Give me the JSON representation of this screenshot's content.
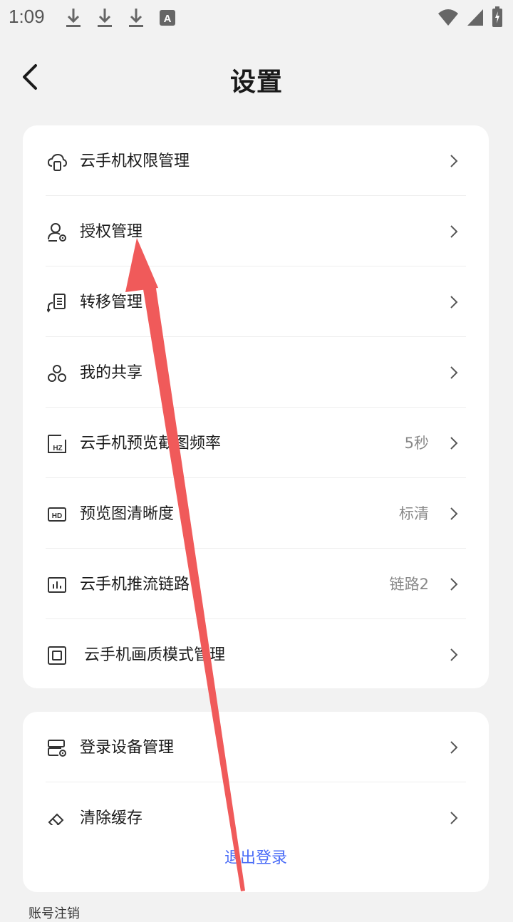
{
  "status_bar": {
    "time": "1:09",
    "left_icons": [
      "download-icon",
      "download-icon",
      "download-icon",
      "a-badge-icon"
    ],
    "right_icons": [
      "wifi-icon",
      "signal-icon",
      "battery-charging-icon"
    ]
  },
  "header": {
    "title": "设置"
  },
  "group1": [
    {
      "label": "云手机权限管理",
      "icon": "cloud-phone-icon",
      "value": ""
    },
    {
      "label": "授权管理",
      "icon": "user-auth-icon",
      "value": ""
    },
    {
      "label": "转移管理",
      "icon": "transfer-icon",
      "value": ""
    },
    {
      "label": "我的共享",
      "icon": "share-icon",
      "value": ""
    },
    {
      "label": "云手机预览截图频率",
      "icon": "hz-icon",
      "value": "5秒"
    },
    {
      "label": "预览图清晰度",
      "icon": "hd-icon",
      "value": "标清"
    },
    {
      "label": "云手机推流链路",
      "icon": "chart-icon",
      "value": "链路2"
    },
    {
      "label": "云手机画质模式管理",
      "icon": "quality-icon",
      "value": ""
    }
  ],
  "group2": [
    {
      "label": "登录设备管理",
      "icon": "device-icon",
      "value": ""
    },
    {
      "label": "清除缓存",
      "icon": "eraser-icon",
      "value": ""
    }
  ],
  "logout_label": "退出登录",
  "bottom_clipped_text": "账号注销",
  "colors": {
    "accent": "#4a6cf7",
    "annotation_arrow": "#f05a5a"
  }
}
